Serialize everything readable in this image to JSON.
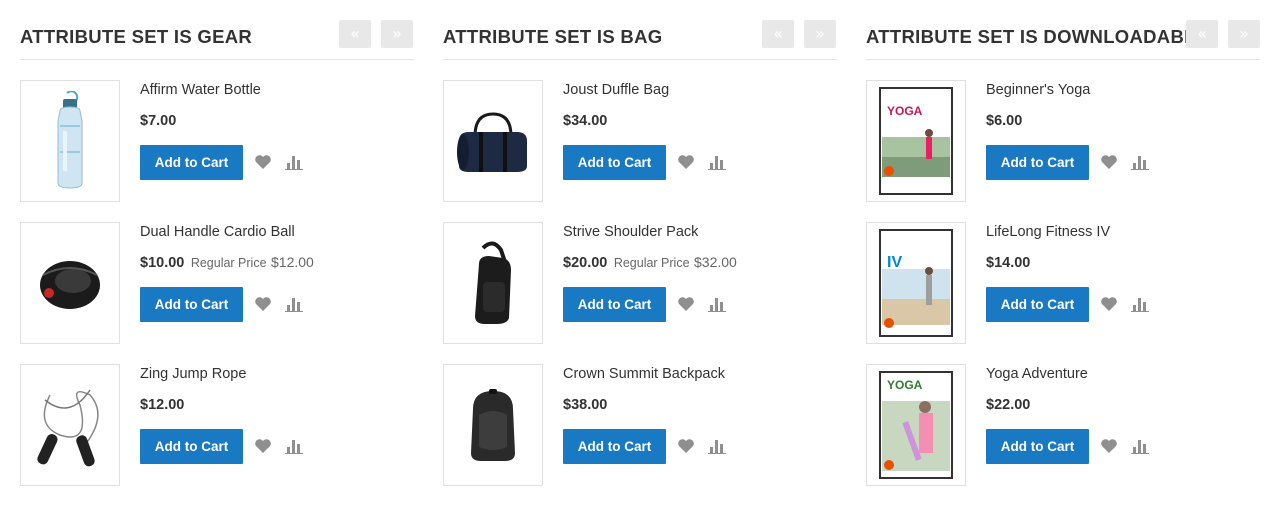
{
  "blocks": [
    {
      "title": "ATTRIBUTE SET IS GEAR",
      "prev_label": "«",
      "next_label": "»",
      "products": [
        {
          "name": "Affirm Water Bottle",
          "price": "$7.00",
          "regular_label": "",
          "regular_price": "",
          "image": "water-bottle"
        },
        {
          "name": "Dual Handle Cardio Ball",
          "price": "$10.00",
          "regular_label": "Regular Price",
          "regular_price": "$12.00",
          "image": "cardio-ball"
        },
        {
          "name": "Zing Jump Rope",
          "price": "$12.00",
          "regular_label": "",
          "regular_price": "",
          "image": "jump-rope"
        }
      ]
    },
    {
      "title": "ATTRIBUTE SET IS BAG",
      "prev_label": "«",
      "next_label": "»",
      "products": [
        {
          "name": "Joust Duffle Bag",
          "price": "$34.00",
          "regular_label": "",
          "regular_price": "",
          "image": "duffle-bag"
        },
        {
          "name": "Strive Shoulder Pack",
          "price": "$20.00",
          "regular_label": "Regular Price",
          "regular_price": "$32.00",
          "image": "shoulder-pack"
        },
        {
          "name": "Crown Summit Backpack",
          "price": "$38.00",
          "regular_label": "",
          "regular_price": "",
          "image": "backpack"
        }
      ]
    },
    {
      "title": "ATTRIBUTE SET IS DOWNLOADABLE",
      "prev_label": "«",
      "next_label": "»",
      "products": [
        {
          "name": "Beginner's Yoga",
          "price": "$6.00",
          "regular_label": "",
          "regular_price": "",
          "image": "yoga-dvd",
          "cover_text": "YOGA"
        },
        {
          "name": "LifeLong Fitness IV",
          "price": "$14.00",
          "regular_label": "",
          "regular_price": "",
          "image": "fitness-dvd",
          "cover_text": "IV"
        },
        {
          "name": "Yoga Adventure",
          "price": "$22.00",
          "regular_label": "",
          "regular_price": "",
          "image": "yoga-adventure-dvd",
          "cover_text": "YOGA"
        }
      ]
    }
  ],
  "add_to_cart_label": "Add to Cart",
  "colors": {
    "accent": "#1979c3",
    "nav_button": "#e8e8e8",
    "icon_gray": "#8f8f8f"
  },
  "icons": {
    "wishlist": "heart-icon",
    "compare": "compare-bars-icon"
  }
}
